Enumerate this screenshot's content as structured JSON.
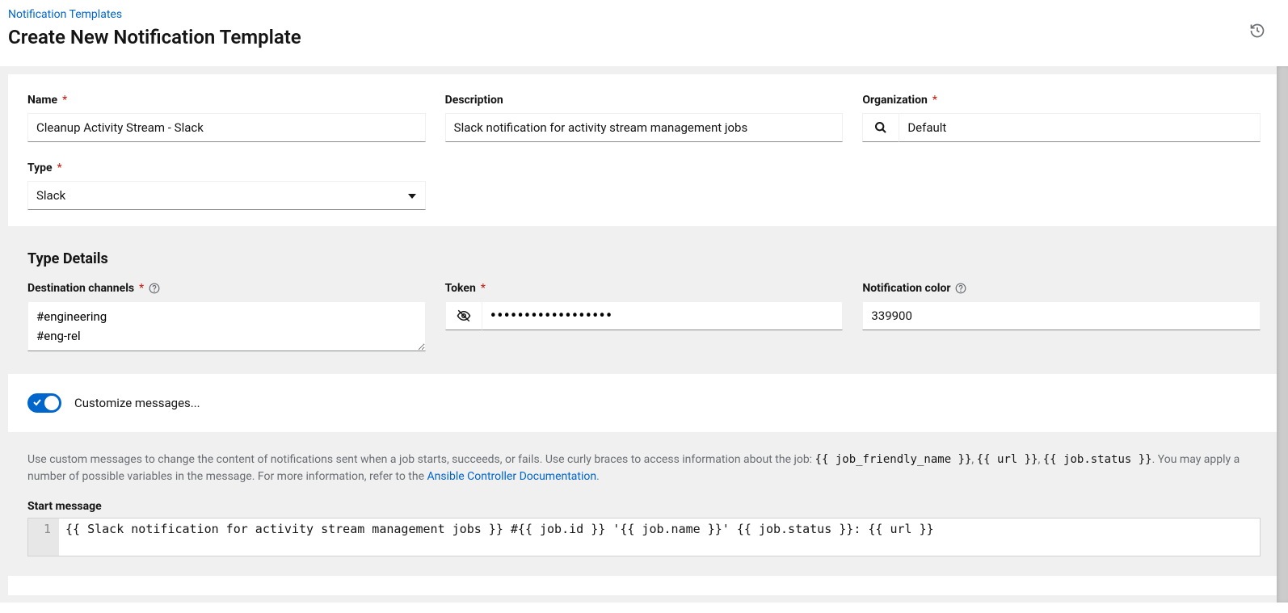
{
  "breadcrumb": {
    "parent_label": "Notification Templates"
  },
  "page_title": "Create New Notification Template",
  "form": {
    "name": {
      "label": "Name",
      "value": "Cleanup Activity Stream - Slack"
    },
    "description": {
      "label": "Description",
      "value": "Slack notification for activity stream management jobs"
    },
    "organization": {
      "label": "Organization",
      "value": "Default"
    },
    "type": {
      "label": "Type",
      "value": "Slack"
    }
  },
  "type_details": {
    "section_title": "Type Details",
    "destination_channels": {
      "label": "Destination channels",
      "value": "#engineering\n#eng-rel"
    },
    "token": {
      "label": "Token",
      "value": "••••••••••••••••••"
    },
    "notification_color": {
      "label": "Notification color",
      "value": "339900"
    }
  },
  "customize": {
    "toggle_label": "Customize messages...",
    "description_pre": "Use custom messages to change the content of notifications sent when a job starts, succeeds, or fails. Use curly braces to access information about the job: ",
    "code1": "{{ job_friendly_name }}",
    "code2": "{{ url }}",
    "code3": "{{ job.status }}",
    "description_mid": ". You may apply a number of possible variables in the message. For more information, refer to the ",
    "doc_link_label": "Ansible Controller Documentation",
    "start_message": {
      "label": "Start message",
      "line_no": "1",
      "content": "{{ Slack notification for activity stream management jobs }} #{{ job.id }} '{{ job.name }}' {{ job.status }}: {{ url }}"
    }
  }
}
